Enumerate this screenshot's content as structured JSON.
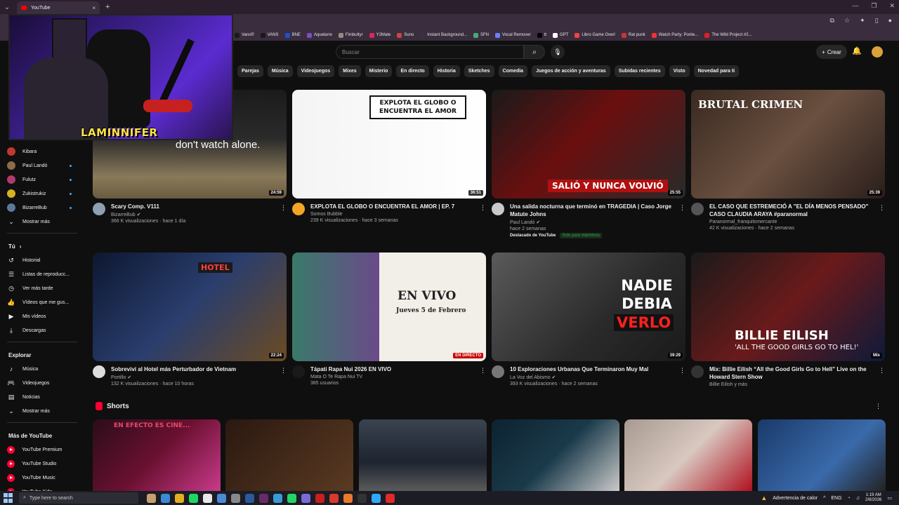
{
  "browser": {
    "tab_title": "YouTube",
    "new_tab": "+",
    "close": "×",
    "bookmarks": [
      "Vans®",
      "VANS",
      "BNE",
      "Aquelarre",
      "Fimbultyr",
      "Y2Mate",
      "Suno",
      "Instant Background...",
      "SFN",
      "Vocal Remover",
      "tt",
      "GPT",
      "Libro Game Overl",
      "Rat punk",
      "Watch Party: Ponte...",
      "The Wild Project #2..."
    ]
  },
  "stream_overlay": {
    "streamer_name": "LAMINNIFER"
  },
  "header": {
    "search_placeholder": "Buscar",
    "create_label": "Crear"
  },
  "chips": [
    "Parejas",
    "Música",
    "Videojuegos",
    "Mixes",
    "Misterio",
    "En directo",
    "Historia",
    "Sketches",
    "Comedia",
    "Juegos de acción y aventuras",
    "Subidas recientes",
    "Visto",
    "Novedad para ti"
  ],
  "sidebar": {
    "subscriptions": [
      {
        "label": "Kibara",
        "color": "#c0392b",
        "live": false
      },
      {
        "label": "Paul Landó",
        "color": "#8e6b4a",
        "live": true
      },
      {
        "label": "Fulutz",
        "color": "#b03a6e",
        "live": true
      },
      {
        "label": "Zukistrukiz",
        "color": "#d6b21f",
        "live": true
      },
      {
        "label": "BizarreBub",
        "color": "#5a7a9a",
        "live": true
      }
    ],
    "show_more": "Mostrar más",
    "you_heading": "Tú",
    "you_items": [
      {
        "label": "Historial",
        "icon": "history-icon",
        "glyph": "↺"
      },
      {
        "label": "Listas de reproducc...",
        "icon": "playlists-icon",
        "glyph": "☰"
      },
      {
        "label": "Ver más tarde",
        "icon": "watch-later-icon",
        "glyph": "◷"
      },
      {
        "label": "Vídeos que me gus...",
        "icon": "like-icon",
        "glyph": "👍"
      },
      {
        "label": "Mis vídeos",
        "icon": "my-videos-icon",
        "glyph": "▶"
      },
      {
        "label": "Descargas",
        "icon": "download-icon",
        "glyph": "⤓"
      }
    ],
    "explore_heading": "Explorar",
    "explore_items": [
      {
        "label": "Música",
        "icon": "music-icon",
        "glyph": "♪"
      },
      {
        "label": "Videojuegos",
        "icon": "gaming-icon",
        "glyph": "🎮"
      },
      {
        "label": "Noticias",
        "icon": "news-icon",
        "glyph": "▤"
      }
    ],
    "explore_more": "Mostrar más",
    "more_heading": "Más de YouTube",
    "more_items": [
      "YouTube Premium",
      "YouTube Studio",
      "YouTube Music",
      "YouTube Kids"
    ]
  },
  "videos": [
    {
      "title": "Scary Comp. V111",
      "channel": "BizarreBub",
      "stats": "366 K visualizaciones · hace 1 día",
      "duration": "24:59",
      "thumb_text": "don't watch alone.",
      "verified": true
    },
    {
      "title": "EXPLOTA EL GLOBO O ENCUENTRA EL AMOR  |  EP. 7",
      "channel": "Somos Bubble",
      "stats": "239 K visualizaciones · hace 3 semanas",
      "duration": "36:51",
      "thumb_text": "EXPLOTA EL GLOBO O ENCUENTRA EL AMOR"
    },
    {
      "title": "Una salida nocturna que terminó en TRAGEDIA | Caso Jorge Matute Johns",
      "channel": "Paul Landó",
      "stats": "hace 2 semanas",
      "duration": "25:55",
      "thumb_text": "SALIÓ Y NUNCA VOLVIÓ",
      "promo": "Destacado de YouTube",
      "members": "Solo para miembros",
      "verified": true
    },
    {
      "title": "EL CASO QUE ESTREMECIÓ A \"EL DÍA MENOS PENSADO\" CASO CLAUDIA ARAYA #paranormal",
      "channel": "Paranormal_franquitomercante",
      "stats": "42 K visualizaciones · hace 2 semanas",
      "duration": "25:39",
      "thumb_text": "BRUTAL CRIMEN"
    },
    {
      "title": "Sobreviví al Hotel más Perturbador de Vietnam",
      "channel": "Portillo",
      "stats": "132 K visualizaciones · hace 10 horas",
      "duration": "22:24",
      "thumb_text": "HOTEL",
      "verified": true
    },
    {
      "title": "Tápati Rapa Nui 2026 EN VIVO",
      "channel": "Mata O Te Rapa Nui TV",
      "stats": "385 usuarios",
      "live_label": "EN DIRECTO",
      "thumb_text": "EN VIVO",
      "thumb_sub": "Jueves 5 de Febrero"
    },
    {
      "title": "10 Exploraciones Urbanas Que Terminaron Muy Mal",
      "channel": "La Voz del Abismo",
      "stats": "393 K visualizaciones · hace 2 semanas",
      "duration": "39:29",
      "thumb_text": "NADIE DEBIA",
      "thumb_text2": "VERLO",
      "verified": true
    },
    {
      "title": "Mix: Billie Eilish “All the Good Girls Go to Hell” Live on the Howard Stern Show",
      "channel": "Billie Eilish y más",
      "stats": "",
      "mix_label": "Mix",
      "thumb_text": "BILLIE EILISH",
      "thumb_sub": "'ALL THE GOOD GIRLS GO TO HEL!'"
    }
  ],
  "shorts": {
    "heading": "Shorts",
    "first_caption": "EN EFECTO ES CINE..."
  },
  "taskbar": {
    "search_placeholder": "Type here to search",
    "weather": "Advertencia de calor",
    "lang": "ENG",
    "time": "1:19 AM",
    "date": "2/6/2026"
  }
}
